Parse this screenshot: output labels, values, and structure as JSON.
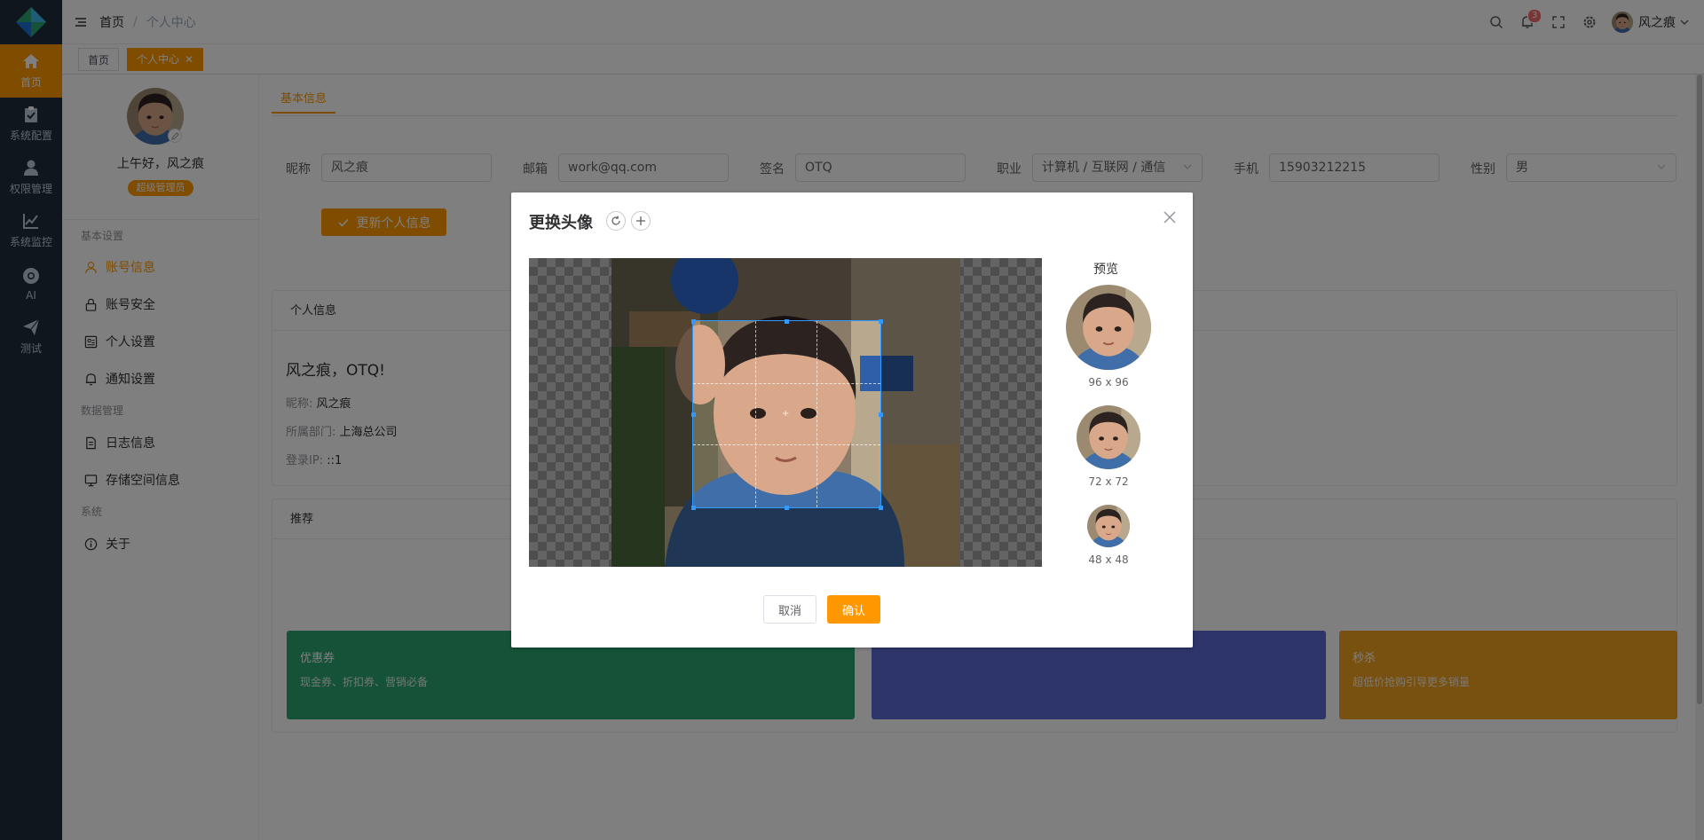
{
  "sidebar": {
    "items": [
      {
        "label": "首页",
        "icon": "home-icon"
      },
      {
        "label": "系统配置",
        "icon": "clipboard-check-icon"
      },
      {
        "label": "权限管理",
        "icon": "user-icon"
      },
      {
        "label": "系统监控",
        "icon": "chart-line-icon"
      },
      {
        "label": "AI",
        "icon": "chrome-icon"
      },
      {
        "label": "测试",
        "icon": "paper-plane-icon"
      }
    ]
  },
  "header": {
    "breadcrumb_home": "首页",
    "breadcrumb_sep": "/",
    "breadcrumb_current": "个人中心",
    "notification_count": "3",
    "username": "风之痕"
  },
  "tags": {
    "home": "首页",
    "current": "个人中心",
    "close": "✕"
  },
  "profile": {
    "greeting": "上午好，风之痕",
    "role": "超级管理员",
    "groups": {
      "basic": "基本设置",
      "data": "数据管理",
      "system": "系统"
    },
    "menu": [
      "账号信息",
      "账号安全",
      "个人设置",
      "通知设置",
      "日志信息",
      "存储空间信息",
      "关于"
    ]
  },
  "form": {
    "tab": "基本信息",
    "nickname_label": "昵称",
    "nickname": "风之痕",
    "email_label": "邮箱",
    "email": "work@qq.com",
    "sign_label": "签名",
    "sign": "OTQ",
    "job_label": "职业",
    "job": "计算机 / 互联网 / 通信",
    "phone_label": "手机",
    "phone": "15903212215",
    "gender_label": "性别",
    "gender": "男",
    "update_btn": "更新个人信息"
  },
  "personal": {
    "title": "个人信息",
    "name_line": "风之痕，OTQ!",
    "nick_label": "昵称:",
    "nick": "风之痕",
    "dept_label": "所属部门:",
    "dept": "上海总公司",
    "ip_label": "登录IP:",
    "ip": "::1"
  },
  "recommend": {
    "title": "推荐",
    "cards": [
      {
        "title": "优惠券",
        "desc": "现金券、折扣券、营销必备",
        "color": "#2ba471"
      },
      {
        "title": "秒杀",
        "desc": "超低价抢购引导更多销量",
        "color": "#f0a020"
      }
    ],
    "mid_color": "#5b6bd6"
  },
  "dialog": {
    "title": "更换头像",
    "preview_title": "预览",
    "sizes": [
      "96 x 96",
      "72 x 72",
      "48 x 48"
    ],
    "cancel": "取消",
    "confirm": "确认"
  },
  "colors": {
    "accent": "#ff9800",
    "sidebar_bg": "#1f2d3d",
    "crop_outline": "#3399ff"
  }
}
